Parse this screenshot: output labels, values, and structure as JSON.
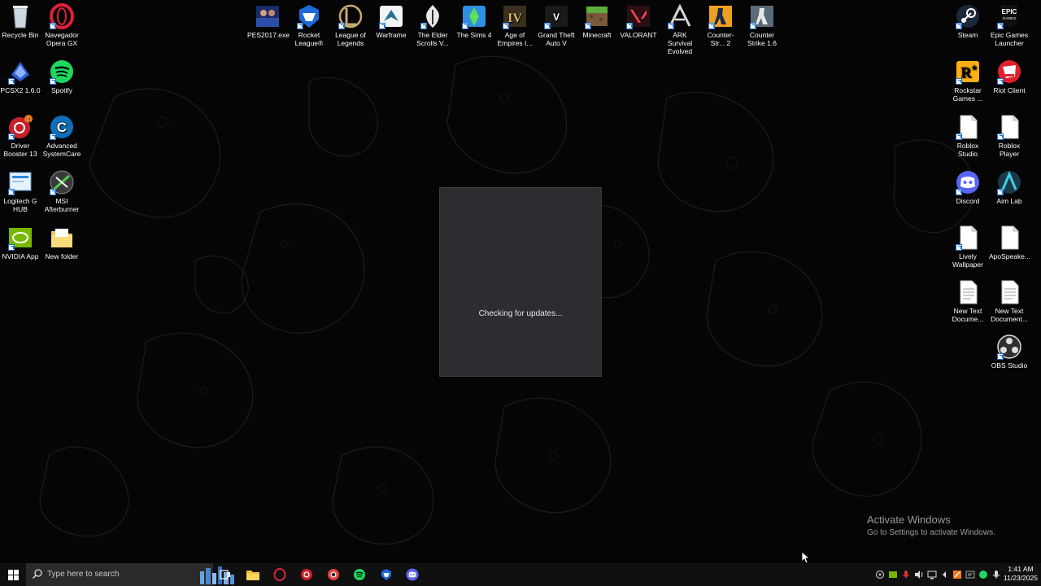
{
  "desktop": {
    "left_icons": [
      {
        "label": "Recycle Bin",
        "icon": "recycle-bin-icon"
      },
      {
        "label": "Navegador Opera GX",
        "icon": "opera-gx-icon"
      },
      {
        "label": "PCSX2 1.6.0",
        "icon": "pcsx2-icon"
      },
      {
        "label": "Spotify",
        "icon": "spotify-icon"
      },
      {
        "label": "Driver Booster 13",
        "icon": "driver-booster-icon",
        "badge": "1"
      },
      {
        "label": "Advanced SystemCare",
        "icon": "advanced-systemcare-icon"
      },
      {
        "label": "Logitech G HUB",
        "icon": "logitech-ghub-icon"
      },
      {
        "label": "MSI Afterburner",
        "icon": "msi-afterburner-icon"
      },
      {
        "label": "NVIDIA App",
        "icon": "nvidia-app-icon"
      },
      {
        "label": "New folder",
        "icon": "folder-icon"
      }
    ],
    "top_icons": [
      {
        "label": "PES2017.exe",
        "icon": "pes2017-icon"
      },
      {
        "label": "Rocket League®",
        "icon": "rocket-league-icon"
      },
      {
        "label": "League of Legends",
        "icon": "league-of-legends-icon"
      },
      {
        "label": "Warframe",
        "icon": "warframe-icon"
      },
      {
        "label": "The Elder Scrolls V...",
        "icon": "skyrim-icon"
      },
      {
        "label": "The Sims 4",
        "icon": "sims4-icon"
      },
      {
        "label": "Age of Empires I...",
        "icon": "age-of-empires-icon"
      },
      {
        "label": "Grand Theft Auto V",
        "icon": "gta5-icon"
      },
      {
        "label": "Minecraft",
        "icon": "minecraft-icon"
      },
      {
        "label": "VALORANT",
        "icon": "valorant-icon"
      },
      {
        "label": "ARK Survival Evolved",
        "icon": "ark-icon"
      },
      {
        "label": "Counter-Str... 2",
        "icon": "counter-strike-2-icon"
      },
      {
        "label": "Counter Strike 1.6",
        "icon": "counter-strike-16-icon"
      }
    ],
    "right_icons": [
      {
        "label": "Steam",
        "icon": "steam-icon"
      },
      {
        "label": "Epic Games Launcher",
        "icon": "epic-games-icon"
      },
      {
        "label": "Rockstar Games ...",
        "icon": "rockstar-icon"
      },
      {
        "label": "Riot Client",
        "icon": "riot-client-icon"
      },
      {
        "label": "Roblox Studio",
        "icon": "file-icon"
      },
      {
        "label": "Roblox Player",
        "icon": "file-icon"
      },
      {
        "label": "Discord",
        "icon": "discord-icon"
      },
      {
        "label": "Aim Lab",
        "icon": "aim-lab-icon"
      },
      {
        "label": "Lively Wallpaper",
        "icon": "file-icon"
      },
      {
        "label": "ApoSpeake...",
        "icon": "file-icon"
      },
      {
        "label": "New Text Docume...",
        "icon": "text-document-icon"
      },
      {
        "label": "New Text Document...",
        "icon": "text-document-icon"
      },
      {
        "label": "OBS Studio",
        "icon": "obs-icon"
      }
    ]
  },
  "dialog": {
    "status_text": "Checking for updates..."
  },
  "watermark": {
    "title": "Activate Windows",
    "subtitle": "Go to Settings to activate Windows."
  },
  "taskbar": {
    "search_placeholder": "Type here to search",
    "pinned": [
      "task-view-icon",
      "file-explorer-icon",
      "opera-gx-icon",
      "driver-booster-icon",
      "chrome-like-icon",
      "spotify-icon",
      "rocket-league-icon",
      "discord-icon"
    ],
    "clock": {
      "time": "1:41 AM",
      "date": "11/23/2025"
    }
  },
  "colors": {
    "taskbar": "#101010",
    "dialog": "#2b2d31",
    "spotify": "#1ed760",
    "discord": "#5865f2"
  }
}
